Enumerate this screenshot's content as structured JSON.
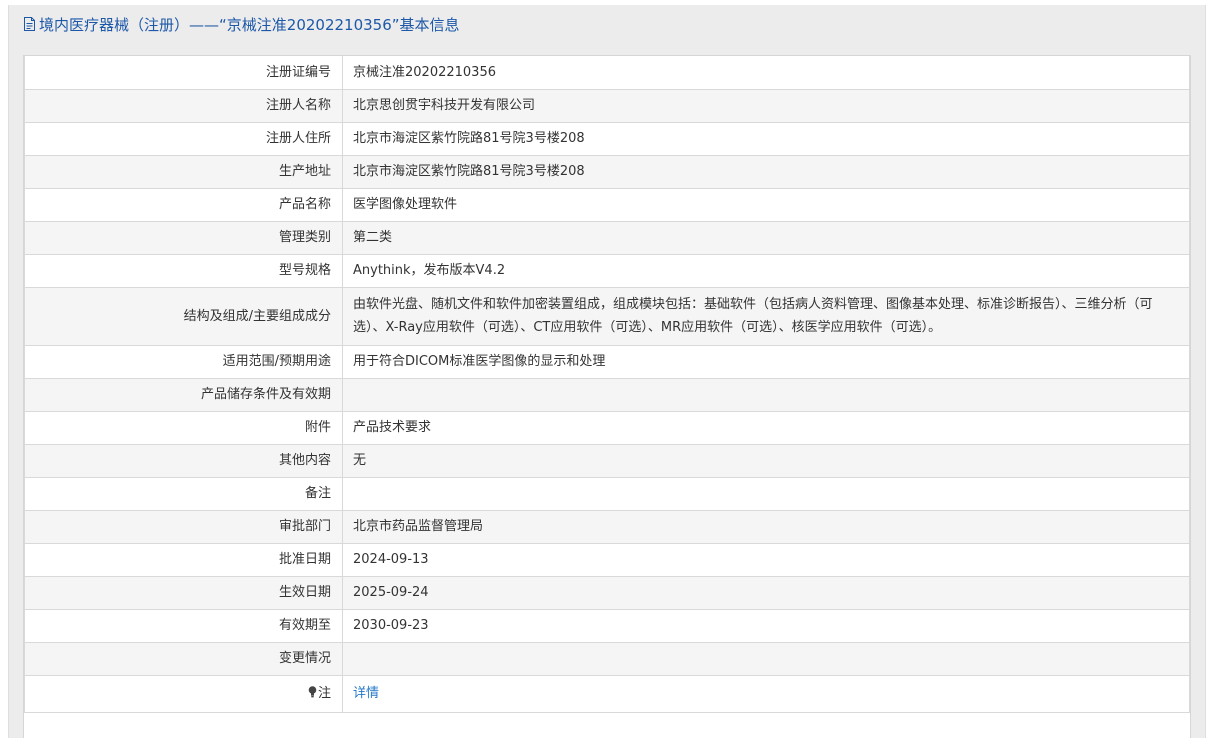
{
  "header": {
    "title": "境内医疗器械（注册）——“京械注准20202210356”基本信息",
    "icon": "document-icon"
  },
  "rows": [
    {
      "label": "注册证编号",
      "value": "京械注准20202210356"
    },
    {
      "label": "注册人名称",
      "value": "北京思创贯宇科技开发有限公司"
    },
    {
      "label": "注册人住所",
      "value": "北京市海淀区紫竹院路81号院3号楼208"
    },
    {
      "label": "生产地址",
      "value": "北京市海淀区紫竹院路81号院3号楼208"
    },
    {
      "label": "产品名称",
      "value": "医学图像处理软件"
    },
    {
      "label": "管理类别",
      "value": "第二类"
    },
    {
      "label": "型号规格",
      "value": "Anythink，发布版本V4.2"
    },
    {
      "label": "结构及组成/主要组成成分",
      "value": "由软件光盘、随机文件和软件加密装置组成，组成模块包括：基础软件（包括病人资料管理、图像基本处理、标准诊断报告）、三维分析（可选）、X-Ray应用软件（可选）、CT应用软件（可选）、MR应用软件（可选）、核医学应用软件（可选）。"
    },
    {
      "label": "适用范围/预期用途",
      "value": "用于符合DICOM标准医学图像的显示和处理"
    },
    {
      "label": "产品储存条件及有效期",
      "value": ""
    },
    {
      "label": "附件",
      "value": "产品技术要求"
    },
    {
      "label": "其他内容",
      "value": "无"
    },
    {
      "label": "备注",
      "value": ""
    },
    {
      "label": "审批部门",
      "value": "北京市药品监督管理局"
    },
    {
      "label": "批准日期",
      "value": "2024-09-13"
    },
    {
      "label": "生效日期",
      "value": "2025-09-24"
    },
    {
      "label": "有效期至",
      "value": "2030-09-23"
    },
    {
      "label": "变更情况",
      "value": ""
    }
  ],
  "note": {
    "label": "注",
    "icon": "lightbulb-icon",
    "link_label": "详情"
  },
  "colors": {
    "title": "#1d58a8",
    "link": "#2479c8",
    "text": "#333333",
    "alt_row": "#f5f5f5",
    "border": "#d9d9d9"
  }
}
